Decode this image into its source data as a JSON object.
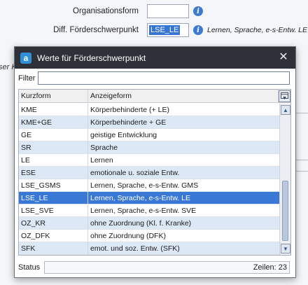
{
  "background": {
    "fields": [
      {
        "label": "Organisationsform",
        "value": ""
      },
      {
        "label": "Diff. Förderschwerpunkt",
        "value": "LSE_LE",
        "hint": "Lernen, Sprache, e-s-Entw. LE"
      }
    ],
    "left_cut_text": "ser K",
    "info_icon_glyph": "i"
  },
  "dialog": {
    "logo_glyph": "a",
    "title": "Werte für Förderschwerpunkt",
    "close_glyph": "✕",
    "filter_label": "Filter",
    "filter_value": "",
    "columns": [
      "Kurzform",
      "Anzeigeform"
    ],
    "column_button_icon": "column-chooser-icon",
    "rows": [
      {
        "kurz": "KME",
        "anzeige": "Körperbehinderte (+ LE)"
      },
      {
        "kurz": "KME+GE",
        "anzeige": "Körperbehinderte + GE"
      },
      {
        "kurz": "GE",
        "anzeige": "geistige Entwicklung"
      },
      {
        "kurz": "SR",
        "anzeige": "Sprache"
      },
      {
        "kurz": "LE",
        "anzeige": "Lernen"
      },
      {
        "kurz": "ESE",
        "anzeige": "emotionale u. soziale Entw."
      },
      {
        "kurz": "LSE_GSMS",
        "anzeige": "Lernen, Sprache, e-s-Entw. GMS"
      },
      {
        "kurz": "LSE_LE",
        "anzeige": "Lernen, Sprache, e-s-Entw. LE"
      },
      {
        "kurz": "LSE_SVE",
        "anzeige": "Lernen, Sprache, e-s-Entw. SVE"
      },
      {
        "kurz": "OZ_KR",
        "anzeige": "ohne Zuordnung (Kl. f. Kranke)"
      },
      {
        "kurz": "OZ_DFK",
        "anzeige": "ohne Zuordnung (DFK)"
      },
      {
        "kurz": "SFK",
        "anzeige": "emot. und soz. Entw. (SFK)"
      }
    ],
    "selected_index": 7,
    "status_label": "Status",
    "status_value": "Zeilen: 23"
  },
  "colors": {
    "titlebar": "#2e3138",
    "selection": "#3a78d6",
    "alt_row": "#dde8f6",
    "info_icon": "#3f7ad1"
  }
}
